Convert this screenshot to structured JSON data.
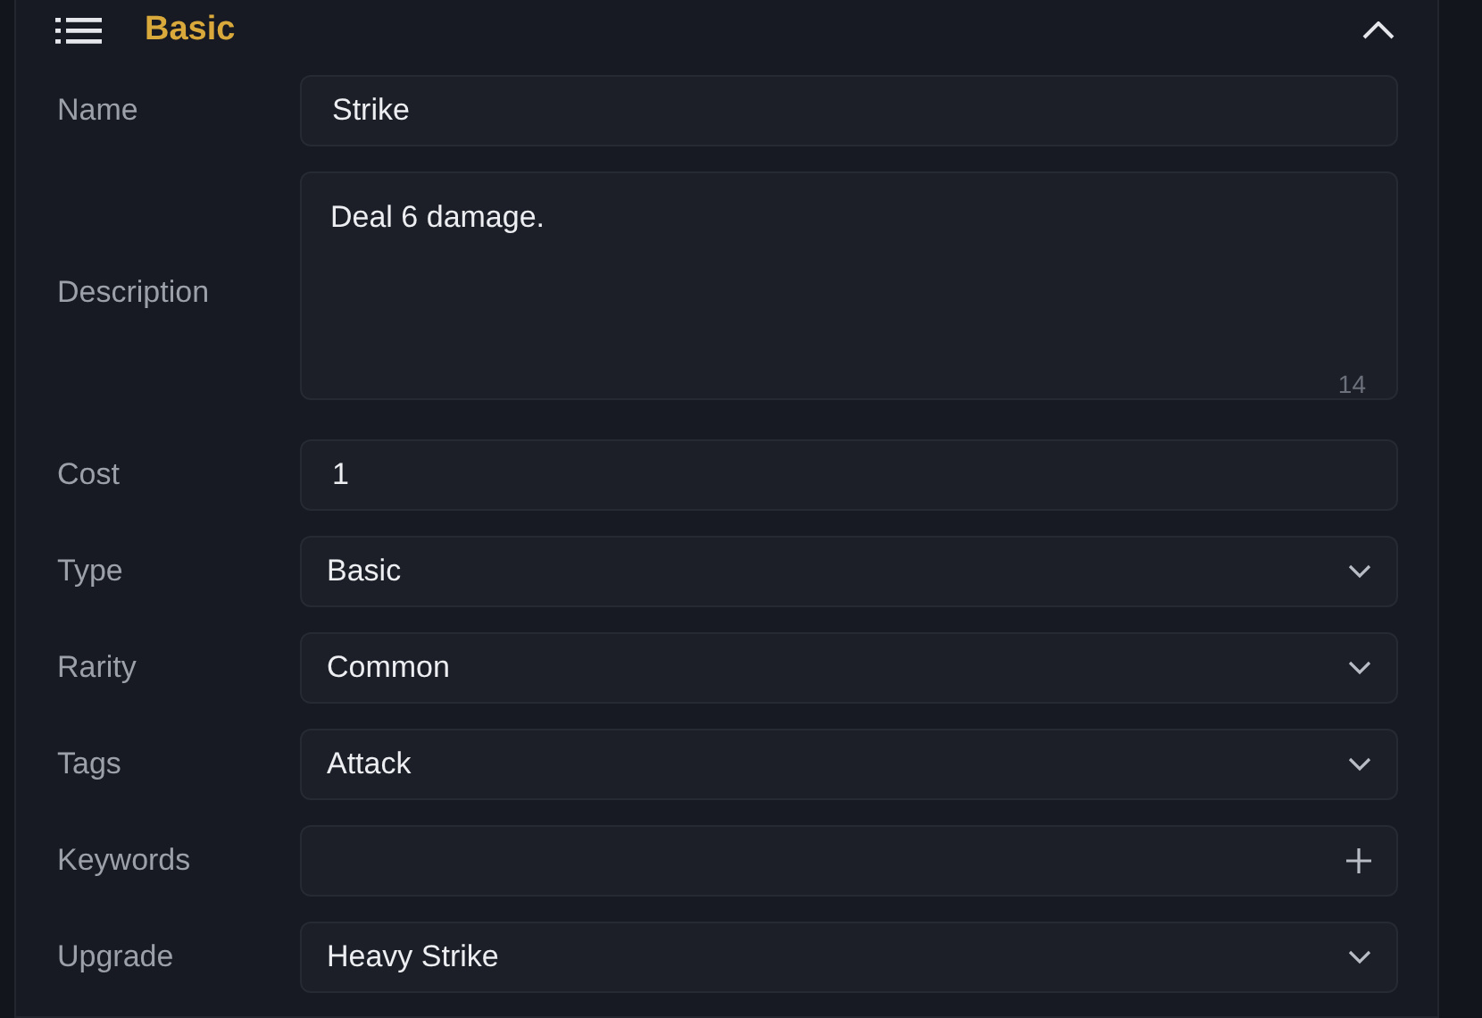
{
  "section": {
    "title": "Basic",
    "expanded": true
  },
  "fields": [
    {
      "kind": "text",
      "label": "Name",
      "value": "Strike"
    },
    {
      "kind": "textarea",
      "label": "Description",
      "value": "Deal 6 damage.",
      "counter": "14"
    },
    {
      "kind": "text",
      "label": "Cost",
      "value": "1"
    },
    {
      "kind": "select",
      "label": "Type",
      "value": "Basic"
    },
    {
      "kind": "select",
      "label": "Rarity",
      "value": "Common"
    },
    {
      "kind": "select",
      "label": "Tags",
      "value": "Attack"
    },
    {
      "kind": "tags",
      "label": "Keywords"
    },
    {
      "kind": "select",
      "label": "Upgrade",
      "value": "Heavy Strike"
    }
  ]
}
